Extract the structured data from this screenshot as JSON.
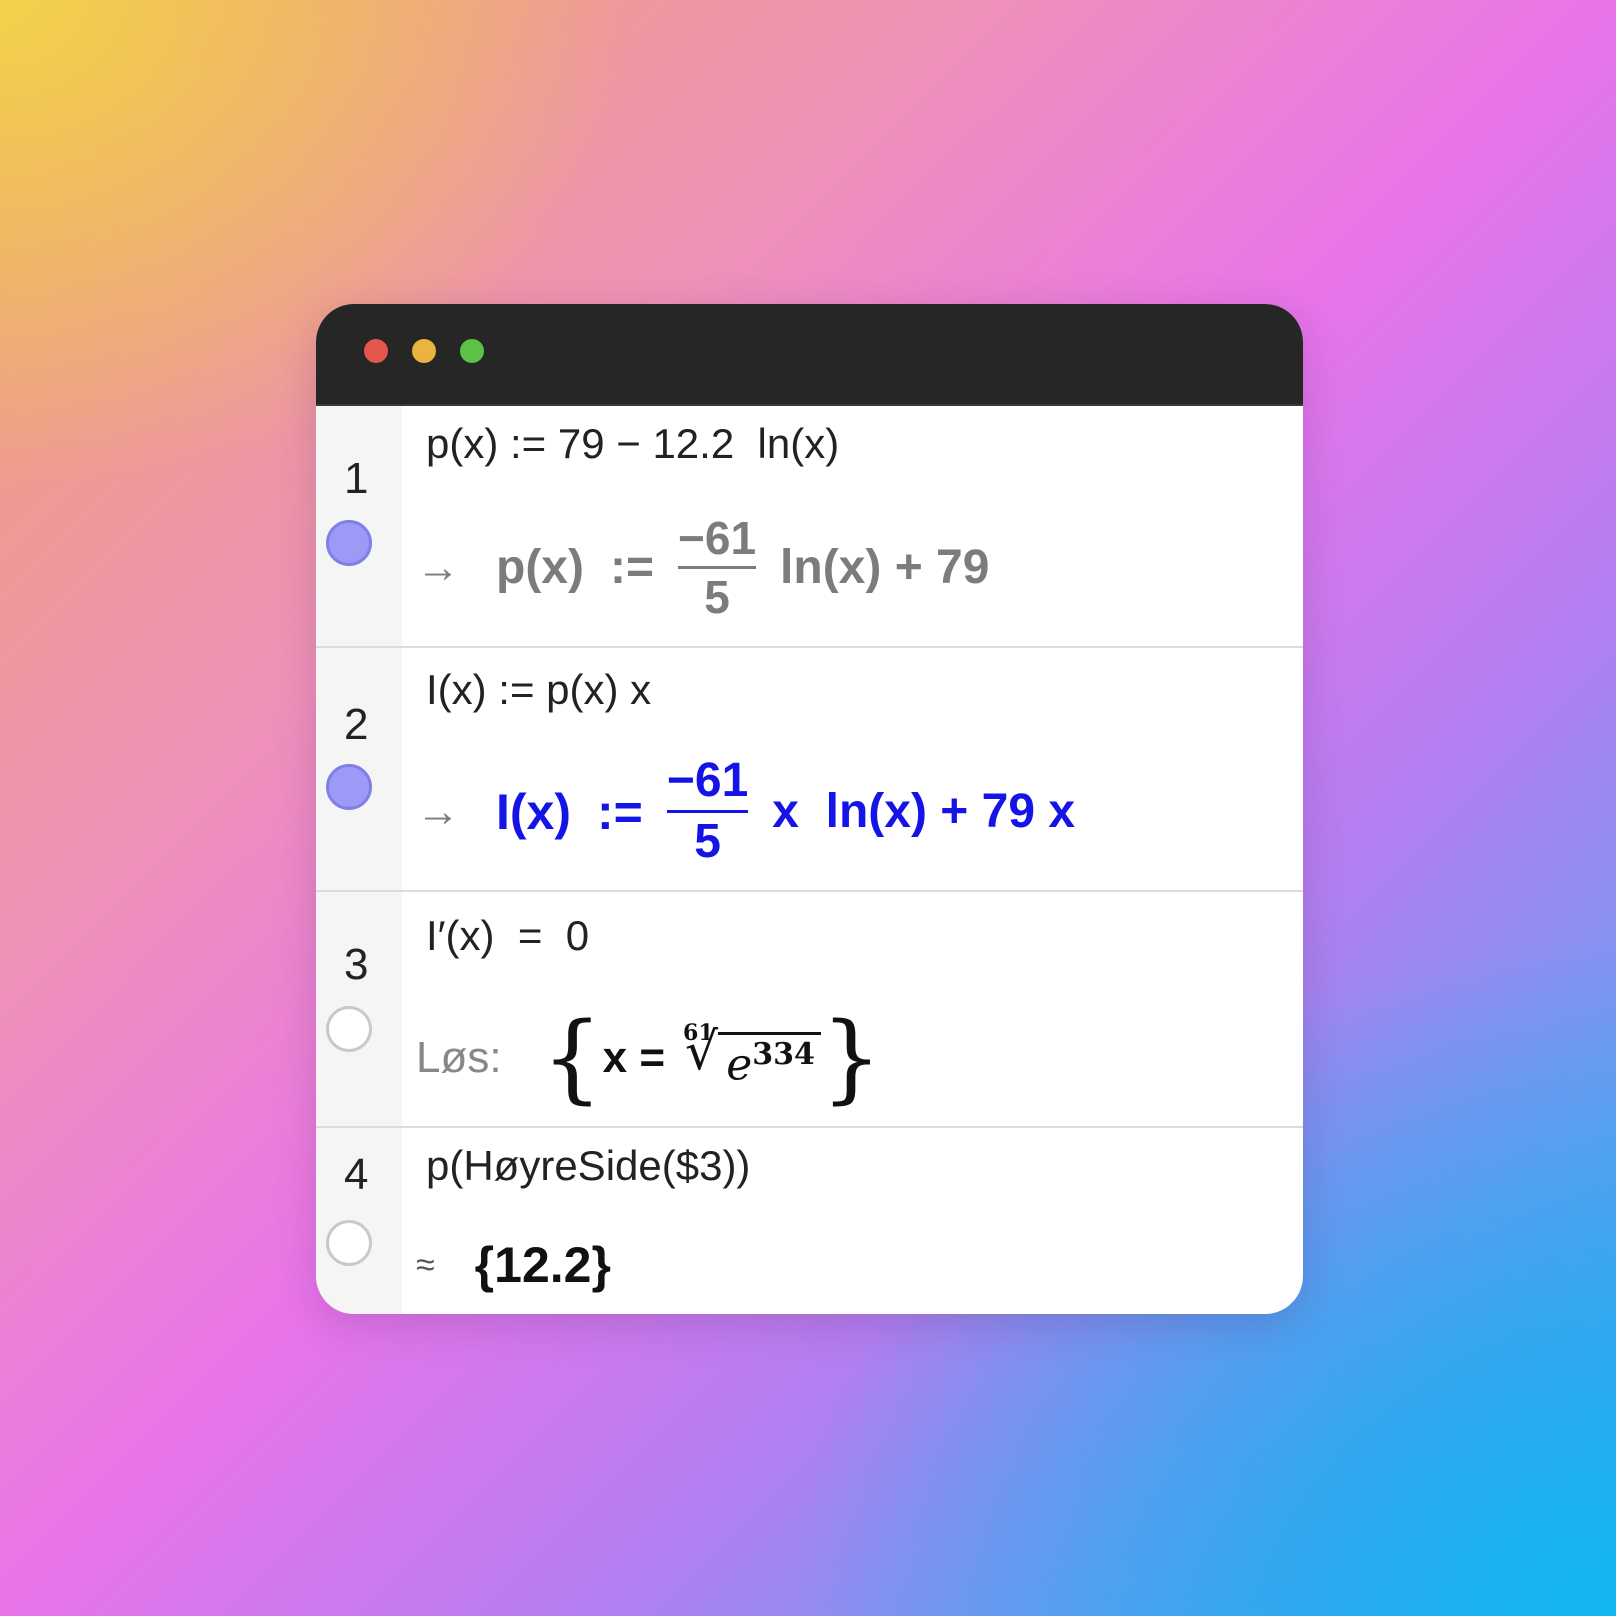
{
  "rows": [
    {
      "number": "1",
      "toggle_state": "on",
      "input": "p(x) := 79 − 12.2  ln(x)",
      "output": {
        "arrow": "→",
        "lhs": "p(x)",
        "assign": ":=",
        "numerator": "−61",
        "denominator": "5",
        "rest": "ln(x) + 79",
        "color": "#7c7c7c"
      }
    },
    {
      "number": "2",
      "toggle_state": "on",
      "input": "I(x) := p(x) x",
      "output": {
        "arrow": "→",
        "lhs": "I(x)",
        "assign": ":=",
        "numerator": "−61",
        "denominator": "5",
        "rest": "x  ln(x) + 79 x",
        "color": "#1414e6"
      }
    },
    {
      "number": "3",
      "toggle_state": "off",
      "input": "I′(x)  =  0",
      "output": {
        "label": "Løs:",
        "brace_open": "{",
        "brace_close": "}",
        "lhs": "x =",
        "root_index": "61",
        "base": "e",
        "exponent": "334"
      }
    },
    {
      "number": "4",
      "toggle_state": "off",
      "input": "p(HøyreSide($3))",
      "output": {
        "approx": "≈",
        "value": "{12.2}"
      }
    }
  ],
  "colors": {
    "output_gray": "#7c7c7c",
    "output_blue": "#1414e6",
    "toggle_on": "#9b9bf7",
    "titlebar": "#262626"
  }
}
